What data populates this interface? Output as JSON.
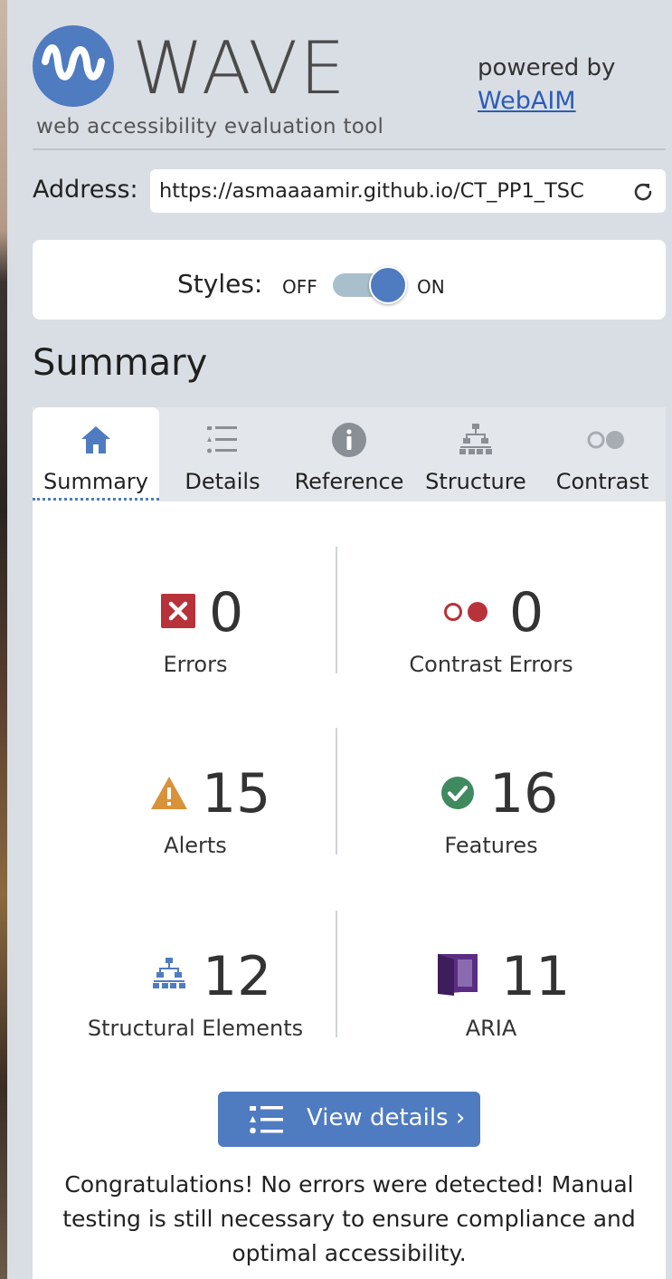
{
  "header": {
    "logo_text": "WAVE",
    "tagline": "web accessibility evaluation tool",
    "powered_by": "powered by",
    "webaim_link": "WebAIM"
  },
  "address": {
    "label": "Address:",
    "value": "https://asmaaaamir.github.io/CT_PP1_TSC",
    "reload_icon": "reload-icon"
  },
  "styles": {
    "label": "Styles:",
    "off": "OFF",
    "on": "ON",
    "state": "on"
  },
  "summary_heading": "Summary",
  "tabs": [
    {
      "label": "Summary",
      "icon": "home-icon",
      "active": true
    },
    {
      "label": "Details",
      "icon": "list-icon",
      "active": false
    },
    {
      "label": "Reference",
      "icon": "info-icon",
      "active": false
    },
    {
      "label": "Structure",
      "icon": "structure-icon",
      "active": false
    },
    {
      "label": "Contrast",
      "icon": "contrast-icon",
      "active": false
    }
  ],
  "stats": {
    "errors": {
      "count": "0",
      "label": "Errors",
      "icon": "error-icon",
      "color": "#b8323a"
    },
    "contrast_errors": {
      "count": "0",
      "label": "Contrast Errors",
      "icon": "contrast-error-icon",
      "color": "#b8323a"
    },
    "alerts": {
      "count": "15",
      "label": "Alerts",
      "icon": "alert-icon",
      "color": "#d9923a"
    },
    "features": {
      "count": "16",
      "label": "Features",
      "icon": "feature-icon",
      "color": "#3f8a5f"
    },
    "structural": {
      "count": "12",
      "label": "Structural Elements",
      "icon": "structure-icon",
      "color": "#4f7bc0"
    },
    "aria": {
      "count": "11",
      "label": "ARIA",
      "icon": "aria-icon",
      "color": "#5a2d82"
    }
  },
  "view_details": {
    "label": "View details ›",
    "icon": "list-icon"
  },
  "message": "Congratulations! No errors were detected! Manual testing is still necessary to ensure compliance and optimal accessibility.",
  "colors": {
    "accent": "#4f7bc0",
    "panel_bg": "#d9dee4",
    "link": "#2b5db8"
  }
}
